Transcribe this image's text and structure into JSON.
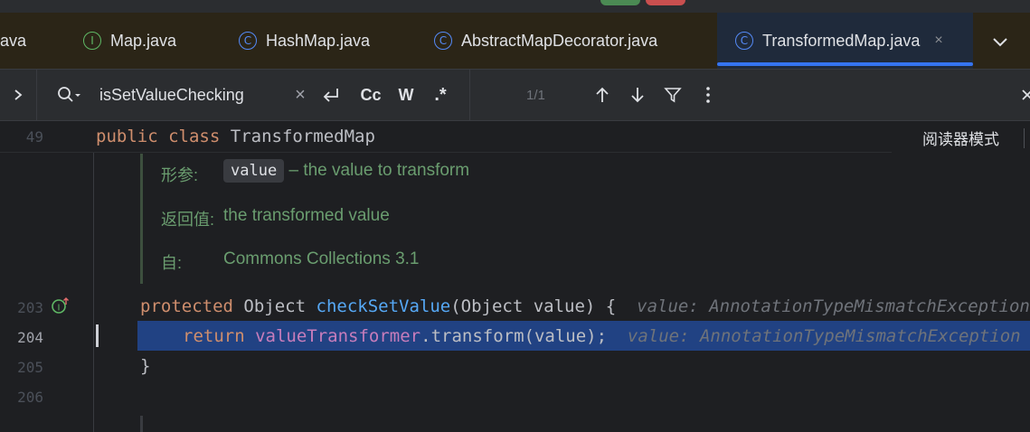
{
  "tabs": [
    {
      "label": "ava",
      "icon": "",
      "active": false
    },
    {
      "label": "Map.java",
      "icon": "interface-icon",
      "active": false
    },
    {
      "label": "HashMap.java",
      "icon": "class-icon",
      "active": false
    },
    {
      "label": "AbstractMapDecorator.java",
      "icon": "class-icon",
      "active": false
    },
    {
      "label": "TransformedMap.java",
      "icon": "class-icon",
      "active": true,
      "close": "×"
    }
  ],
  "icon_glyphs": {
    "interface": "I",
    "class": "C"
  },
  "search": {
    "value": "isSetValueChecking",
    "clear": "×",
    "case_label": "Cc",
    "word_label": "W",
    "regex_label": ".*",
    "match_count": "1/1"
  },
  "editor": {
    "sticky_line_number": "49",
    "sticky_code": {
      "kw1": "public",
      "kw2": "class",
      "name": "TransformedMap"
    },
    "reader_mode": "阅读器模式",
    "doc": {
      "param_label": "形参:",
      "param_name": "value",
      "param_desc": "– the value to transform",
      "returns_label": "返回值:",
      "returns_desc": "the transformed value",
      "since_label": "自:",
      "since_value": "Commons Collections 3.1"
    },
    "lines": {
      "n203": "203",
      "n204": "204",
      "n205": "205",
      "n206": "206"
    },
    "line203": {
      "kw": "protected",
      "type": "Object",
      "method": "checkSetValue",
      "params": "(Object value) {",
      "hint": "value: AnnotationTypeMismatchException"
    },
    "line204": {
      "kw": "return",
      "field": "valueTransformer",
      "rest": ".transform(value);",
      "hint": "value: AnnotationTypeMismatchException"
    },
    "line205": {
      "brace": "}"
    },
    "impl_marker_icon": "implements-method-icon"
  },
  "colors": {
    "accent": "#3574f0",
    "selection": "#214283",
    "keyword": "#cf8e6d",
    "method": "#56a8f5",
    "field": "#c77dbb",
    "doc_text": "#6a9d6f"
  }
}
